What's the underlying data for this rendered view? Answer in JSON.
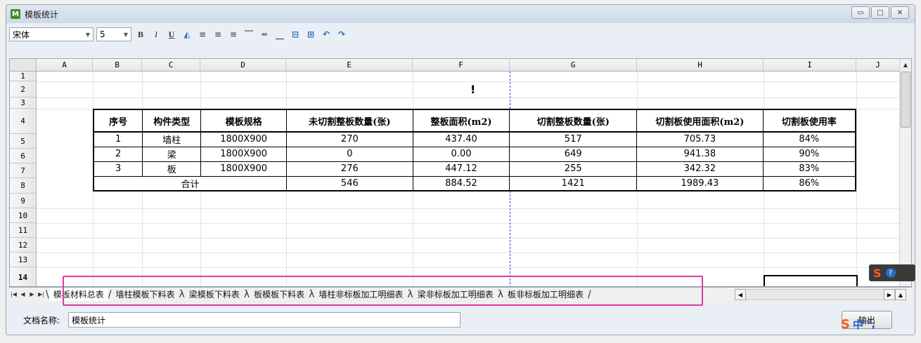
{
  "window": {
    "title": "模板统计",
    "app_icon_letter": "M"
  },
  "toolbar": {
    "font": "宋体",
    "size": "5",
    "bold": "B",
    "italic": "I",
    "underline": "U"
  },
  "columns": [
    "A",
    "B",
    "C",
    "D",
    "E",
    "F",
    "G",
    "H",
    "I",
    "J"
  ],
  "rows": [
    "1",
    "2",
    "3",
    "4",
    "5",
    "6",
    "7",
    "8",
    "9",
    "10",
    "11",
    "12",
    "13",
    "14"
  ],
  "sheet": {
    "warning_mark": "!",
    "table": {
      "headers": [
        "序号",
        "构件类型",
        "模板规格",
        "未切割整板数量(张)",
        "整板面积(m2)",
        "切割整板数量(张)",
        "切割板使用面积(m2)",
        "切割板使用率"
      ],
      "rows": [
        [
          "1",
          "墙柱",
          "1800X900",
          "270",
          "437.40",
          "517",
          "705.73",
          "84%"
        ],
        [
          "2",
          "梁",
          "1800X900",
          "0",
          "0.00",
          "649",
          "941.38",
          "90%"
        ],
        [
          "3",
          "板",
          "1800X900",
          "276",
          "447.12",
          "255",
          "342.32",
          "83%"
        ]
      ],
      "total": {
        "label": "合计",
        "values": [
          "546",
          "884.52",
          "1421",
          "1989.43",
          "86%"
        ]
      }
    }
  },
  "tabs": [
    "模板材料总表",
    "墙柱模板下料表",
    "梁模板下料表",
    "板模板下料表",
    "墙柱非标板加工明细表",
    "梁非标板加工明细表",
    "板非标板加工明细表"
  ],
  "bottom": {
    "doc_name_label": "文档名称:",
    "doc_name_value": "模板统计",
    "export_label": "输出"
  },
  "ime": {
    "logo": "S",
    "help": "?",
    "mode": "中",
    "punct": "°,"
  }
}
